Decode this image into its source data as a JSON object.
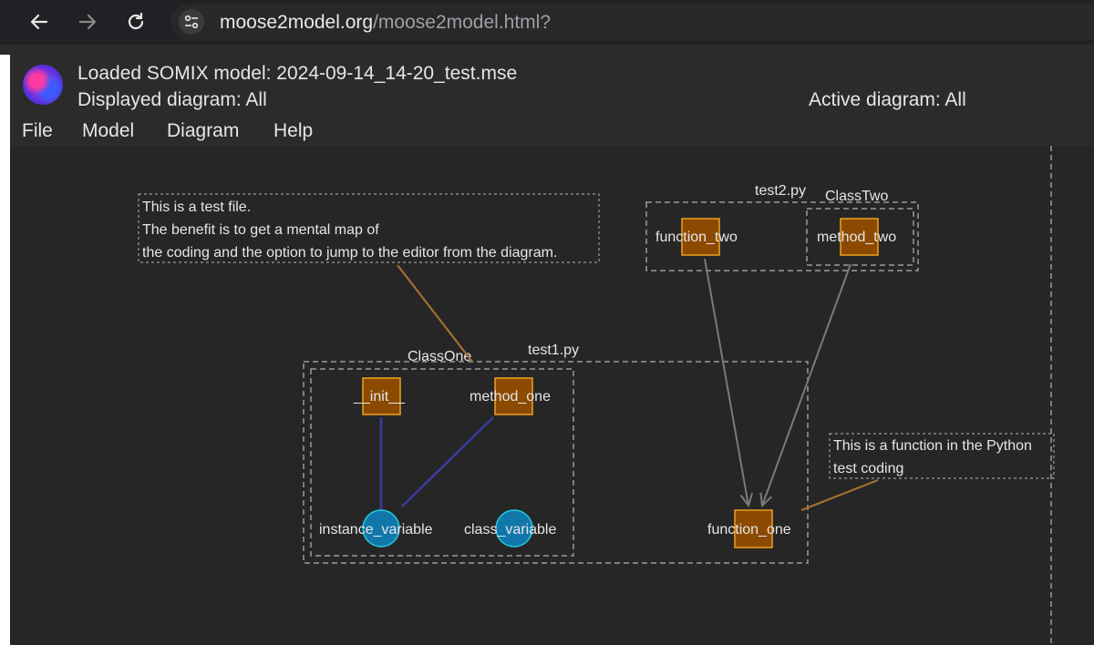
{
  "browser": {
    "url_host": "moose2model.org",
    "url_path": "/moose2model.html?"
  },
  "header": {
    "loaded_model_label": "Loaded SOMIX model: 2024-09-14_14-20_test.mse",
    "displayed_diagram_label": "Displayed diagram: All",
    "active_diagram_label": "Active diagram: All"
  },
  "menu": {
    "file": "File",
    "model": "Model",
    "diagram": "Diagram",
    "help": "Help"
  },
  "diagram": {
    "groups": {
      "test2": "test2.py",
      "class_two": "ClassTwo",
      "test1": "test1.py",
      "class_one": "ClassOne"
    },
    "nodes": {
      "function_two": "function_two",
      "method_two": "method_two",
      "init": "__init__",
      "method_one": "method_one",
      "instance_variable": "instance_variable",
      "class_variable": "class_variable",
      "function_one": "function_one"
    },
    "comments": {
      "file_note": [
        "This is a test file.",
        "The benefit is to get a mental map of",
        "the coding and the option to jump to the editor from the diagram."
      ],
      "function_note": [
        "This is a function in the Python",
        "test coding"
      ]
    },
    "colors": {
      "code_node": "#8b4a00",
      "code_node_border": "#f0a020",
      "data_node": "#1177aa",
      "data_node_border": "#22ccdd",
      "access_link": "#3a3aa0",
      "call_link": "#7a7a7a",
      "comment_link": "#a07030",
      "group_border": "#9a9a9a"
    }
  }
}
